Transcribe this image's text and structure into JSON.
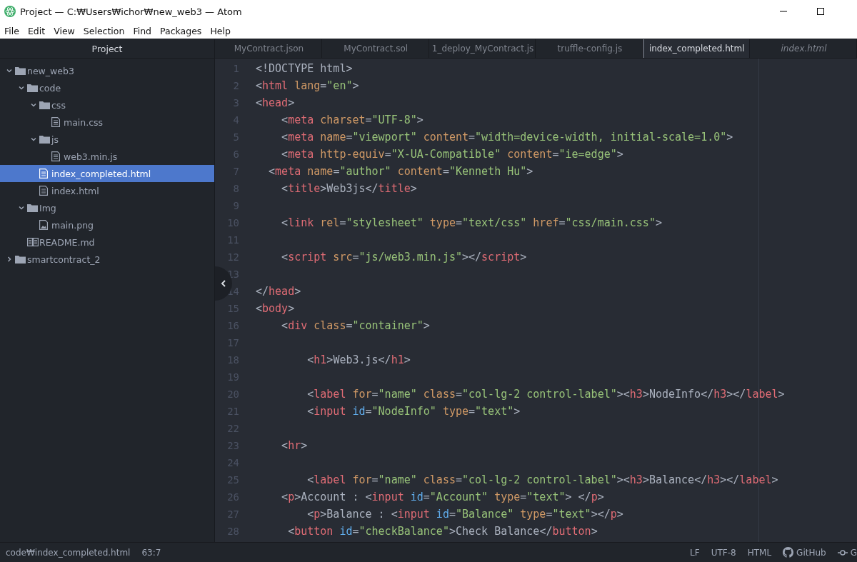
{
  "window": {
    "title": "Project — C:₩Users₩ichor₩new_web3 — Atom"
  },
  "menu": [
    "File",
    "Edit",
    "View",
    "Selection",
    "Find",
    "Packages",
    "Help"
  ],
  "sidebar": {
    "title": "Project",
    "tree": [
      {
        "name": "new_web3",
        "kind": "folder",
        "expanded": true,
        "selected": false,
        "children": [
          {
            "name": "code",
            "kind": "folder",
            "expanded": true,
            "selected": false,
            "children": [
              {
                "name": "css",
                "kind": "folder",
                "expanded": true,
                "selected": false,
                "children": [
                  {
                    "name": "main.css",
                    "kind": "file",
                    "selected": false
                  }
                ]
              },
              {
                "name": "js",
                "kind": "folder",
                "expanded": true,
                "selected": false,
                "children": [
                  {
                    "name": "web3.min.js",
                    "kind": "file",
                    "selected": false
                  }
                ]
              },
              {
                "name": "index_completed.html",
                "kind": "file",
                "selected": true
              },
              {
                "name": "index.html",
                "kind": "file",
                "selected": false
              }
            ]
          },
          {
            "name": "Img",
            "kind": "folder",
            "expanded": true,
            "selected": false,
            "children": [
              {
                "name": "main.png",
                "kind": "image",
                "selected": false
              }
            ]
          },
          {
            "name": "README.md",
            "kind": "readme",
            "selected": false
          }
        ]
      },
      {
        "name": "smartcontract_2",
        "kind": "folder",
        "expanded": false,
        "selected": false
      }
    ]
  },
  "tabs": [
    {
      "label": "MyContract.json",
      "selected": false,
      "pending": false
    },
    {
      "label": "MyContract.sol",
      "selected": false,
      "pending": false
    },
    {
      "label": "1_deploy_MyContract.js",
      "selected": false,
      "pending": false
    },
    {
      "label": "truffle-config.js",
      "selected": false,
      "pending": false
    },
    {
      "label": "index_completed.html",
      "selected": true,
      "pending": false
    },
    {
      "label": "index.html",
      "selected": false,
      "pending": true
    }
  ],
  "editor": {
    "lines": [
      {
        "number": "1",
        "tokens": [
          {
            "kind": "text",
            "text": "<!DOCTYPE html>"
          }
        ]
      },
      {
        "number": "2",
        "tokens": [
          {
            "kind": "punct",
            "text": "<"
          },
          {
            "kind": "tag",
            "text": "html"
          },
          {
            "kind": "attr",
            "text": " lang"
          },
          {
            "kind": "punct",
            "text": "="
          },
          {
            "kind": "string",
            "text": "\"en\""
          },
          {
            "kind": "punct",
            "text": ">"
          }
        ]
      },
      {
        "number": "3",
        "tokens": [
          {
            "kind": "punct",
            "text": "<"
          },
          {
            "kind": "tag",
            "text": "head"
          },
          {
            "kind": "punct",
            "text": ">"
          }
        ]
      },
      {
        "number": "4",
        "tokens": [
          {
            "kind": "punct",
            "text": "    <"
          },
          {
            "kind": "tag",
            "text": "meta"
          },
          {
            "kind": "attr",
            "text": " charset"
          },
          {
            "kind": "punct",
            "text": "="
          },
          {
            "kind": "string",
            "text": "\"UTF-8\""
          },
          {
            "kind": "punct",
            "text": ">"
          }
        ]
      },
      {
        "number": "5",
        "tokens": [
          {
            "kind": "punct",
            "text": "    <"
          },
          {
            "kind": "tag",
            "text": "meta"
          },
          {
            "kind": "attr",
            "text": " name"
          },
          {
            "kind": "punct",
            "text": "="
          },
          {
            "kind": "string",
            "text": "\"viewport\""
          },
          {
            "kind": "attr",
            "text": " content"
          },
          {
            "kind": "punct",
            "text": "="
          },
          {
            "kind": "string",
            "text": "\"width=device-width, initial-scale=1.0\""
          },
          {
            "kind": "punct",
            "text": ">"
          }
        ]
      },
      {
        "number": "6",
        "tokens": [
          {
            "kind": "punct",
            "text": "    <"
          },
          {
            "kind": "tag",
            "text": "meta"
          },
          {
            "kind": "attr",
            "text": " http-equiv"
          },
          {
            "kind": "punct",
            "text": "="
          },
          {
            "kind": "string",
            "text": "\"X-UA-Compatible\""
          },
          {
            "kind": "attr",
            "text": " content"
          },
          {
            "kind": "punct",
            "text": "="
          },
          {
            "kind": "string",
            "text": "\"ie=edge\""
          },
          {
            "kind": "punct",
            "text": ">"
          }
        ]
      },
      {
        "number": "7",
        "tokens": [
          {
            "kind": "punct",
            "text": "  <"
          },
          {
            "kind": "tag",
            "text": "meta"
          },
          {
            "kind": "attr",
            "text": " name"
          },
          {
            "kind": "punct",
            "text": "="
          },
          {
            "kind": "string",
            "text": "\"author\""
          },
          {
            "kind": "attr",
            "text": " content"
          },
          {
            "kind": "punct",
            "text": "="
          },
          {
            "kind": "string",
            "text": "\"Kenneth Hu\""
          },
          {
            "kind": "punct",
            "text": ">"
          }
        ]
      },
      {
        "number": "8",
        "tokens": [
          {
            "kind": "punct",
            "text": "    <"
          },
          {
            "kind": "tag",
            "text": "title"
          },
          {
            "kind": "punct",
            "text": ">"
          },
          {
            "kind": "text",
            "text": "Web3js"
          },
          {
            "kind": "punct",
            "text": "</"
          },
          {
            "kind": "tag",
            "text": "title"
          },
          {
            "kind": "punct",
            "text": ">"
          }
        ]
      },
      {
        "number": "9"
      },
      {
        "number": "10",
        "tokens": [
          {
            "kind": "punct",
            "text": "    <"
          },
          {
            "kind": "tag",
            "text": "link"
          },
          {
            "kind": "attr",
            "text": " rel"
          },
          {
            "kind": "punct",
            "text": "="
          },
          {
            "kind": "string",
            "text": "\"stylesheet\""
          },
          {
            "kind": "attr",
            "text": " type"
          },
          {
            "kind": "punct",
            "text": "="
          },
          {
            "kind": "string",
            "text": "\"text/css\""
          },
          {
            "kind": "attr",
            "text": " href"
          },
          {
            "kind": "punct",
            "text": "="
          },
          {
            "kind": "string",
            "text": "\"css/main.css\""
          },
          {
            "kind": "punct",
            "text": ">"
          }
        ]
      },
      {
        "number": "11"
      },
      {
        "number": "12",
        "tokens": [
          {
            "kind": "punct",
            "text": "    <"
          },
          {
            "kind": "tag",
            "text": "script"
          },
          {
            "kind": "attr",
            "text": " src"
          },
          {
            "kind": "punct",
            "text": "="
          },
          {
            "kind": "string",
            "text": "\"js/web3.min.js\""
          },
          {
            "kind": "punct",
            "text": "></"
          },
          {
            "kind": "tag",
            "text": "script"
          },
          {
            "kind": "punct",
            "text": ">"
          }
        ]
      },
      {
        "number": "13"
      },
      {
        "number": "14",
        "tokens": [
          {
            "kind": "punct",
            "text": "</"
          },
          {
            "kind": "tag",
            "text": "head"
          },
          {
            "kind": "punct",
            "text": ">"
          }
        ]
      },
      {
        "number": "15",
        "tokens": [
          {
            "kind": "punct",
            "text": "<"
          },
          {
            "kind": "tag",
            "text": "body"
          },
          {
            "kind": "punct",
            "text": ">"
          }
        ]
      },
      {
        "number": "16",
        "tokens": [
          {
            "kind": "punct",
            "text": "    <"
          },
          {
            "kind": "tag",
            "text": "div"
          },
          {
            "kind": "attr",
            "text": " class"
          },
          {
            "kind": "punct",
            "text": "="
          },
          {
            "kind": "string",
            "text": "\"container\""
          },
          {
            "kind": "punct",
            "text": ">"
          }
        ]
      },
      {
        "number": "17"
      },
      {
        "number": "18",
        "tokens": [
          {
            "kind": "punct",
            "text": "        <"
          },
          {
            "kind": "tag",
            "text": "h1"
          },
          {
            "kind": "punct",
            "text": ">"
          },
          {
            "kind": "text",
            "text": "Web3.js"
          },
          {
            "kind": "punct",
            "text": "</"
          },
          {
            "kind": "tag",
            "text": "h1"
          },
          {
            "kind": "punct",
            "text": ">"
          }
        ]
      },
      {
        "number": "19"
      },
      {
        "number": "20",
        "tokens": [
          {
            "kind": "punct",
            "text": "        <"
          },
          {
            "kind": "tag",
            "text": "label"
          },
          {
            "kind": "attr",
            "text": " for"
          },
          {
            "kind": "punct",
            "text": "="
          },
          {
            "kind": "string",
            "text": "\"name\""
          },
          {
            "kind": "attr",
            "text": " class"
          },
          {
            "kind": "punct",
            "text": "="
          },
          {
            "kind": "string",
            "text": "\"col-lg-2 control-label\""
          },
          {
            "kind": "punct",
            "text": "><"
          },
          {
            "kind": "tag",
            "text": "h3"
          },
          {
            "kind": "punct",
            "text": ">"
          },
          {
            "kind": "text",
            "text": "NodeInfo"
          },
          {
            "kind": "punct",
            "text": "</"
          },
          {
            "kind": "tag",
            "text": "h3"
          },
          {
            "kind": "punct",
            "text": "></"
          },
          {
            "kind": "tag",
            "text": "label"
          },
          {
            "kind": "punct",
            "text": ">"
          }
        ]
      },
      {
        "number": "21",
        "tokens": [
          {
            "kind": "punct",
            "text": "        <"
          },
          {
            "kind": "tag",
            "text": "input"
          },
          {
            "kind": "id",
            "text": " id"
          },
          {
            "kind": "punct",
            "text": "="
          },
          {
            "kind": "string",
            "text": "\"NodeInfo\""
          },
          {
            "kind": "attr",
            "text": " type"
          },
          {
            "kind": "punct",
            "text": "="
          },
          {
            "kind": "string",
            "text": "\"text\""
          },
          {
            "kind": "punct",
            "text": ">"
          }
        ]
      },
      {
        "number": "22"
      },
      {
        "number": "23",
        "tokens": [
          {
            "kind": "punct",
            "text": "    <"
          },
          {
            "kind": "tag",
            "text": "hr"
          },
          {
            "kind": "punct",
            "text": ">"
          }
        ]
      },
      {
        "number": "24"
      },
      {
        "number": "25",
        "tokens": [
          {
            "kind": "punct",
            "text": "        <"
          },
          {
            "kind": "tag",
            "text": "label"
          },
          {
            "kind": "attr",
            "text": " for"
          },
          {
            "kind": "punct",
            "text": "="
          },
          {
            "kind": "string",
            "text": "\"name\""
          },
          {
            "kind": "attr",
            "text": " class"
          },
          {
            "kind": "punct",
            "text": "="
          },
          {
            "kind": "string",
            "text": "\"col-lg-2 control-label\""
          },
          {
            "kind": "punct",
            "text": "><"
          },
          {
            "kind": "tag",
            "text": "h3"
          },
          {
            "kind": "punct",
            "text": ">"
          },
          {
            "kind": "text",
            "text": "Balance"
          },
          {
            "kind": "punct",
            "text": "</"
          },
          {
            "kind": "tag",
            "text": "h3"
          },
          {
            "kind": "punct",
            "text": "></"
          },
          {
            "kind": "tag",
            "text": "label"
          },
          {
            "kind": "punct",
            "text": ">"
          }
        ]
      },
      {
        "number": "26",
        "tokens": [
          {
            "kind": "punct",
            "text": "    <"
          },
          {
            "kind": "tag",
            "text": "p"
          },
          {
            "kind": "punct",
            "text": ">"
          },
          {
            "kind": "text",
            "text": "Account : "
          },
          {
            "kind": "punct",
            "text": "<"
          },
          {
            "kind": "tag",
            "text": "input"
          },
          {
            "kind": "id",
            "text": " id"
          },
          {
            "kind": "punct",
            "text": "="
          },
          {
            "kind": "string",
            "text": "\"Account\""
          },
          {
            "kind": "attr",
            "text": " type"
          },
          {
            "kind": "punct",
            "text": "="
          },
          {
            "kind": "string",
            "text": "\"text\""
          },
          {
            "kind": "punct",
            "text": "> </"
          },
          {
            "kind": "tag",
            "text": "p"
          },
          {
            "kind": "punct",
            "text": ">"
          }
        ]
      },
      {
        "number": "27",
        "tokens": [
          {
            "kind": "punct",
            "text": "        <"
          },
          {
            "kind": "tag",
            "text": "p"
          },
          {
            "kind": "punct",
            "text": ">"
          },
          {
            "kind": "text",
            "text": "Balance : "
          },
          {
            "kind": "punct",
            "text": "<"
          },
          {
            "kind": "tag",
            "text": "input"
          },
          {
            "kind": "id",
            "text": " id"
          },
          {
            "kind": "punct",
            "text": "="
          },
          {
            "kind": "string",
            "text": "\"Balance\""
          },
          {
            "kind": "attr",
            "text": " type"
          },
          {
            "kind": "punct",
            "text": "="
          },
          {
            "kind": "string",
            "text": "\"text\""
          },
          {
            "kind": "punct",
            "text": "></"
          },
          {
            "kind": "tag",
            "text": "p"
          },
          {
            "kind": "punct",
            "text": ">"
          }
        ]
      },
      {
        "number": "28",
        "tokens": [
          {
            "kind": "punct",
            "text": "     <"
          },
          {
            "kind": "tag",
            "text": "button"
          },
          {
            "kind": "id",
            "text": " id"
          },
          {
            "kind": "punct",
            "text": "="
          },
          {
            "kind": "string",
            "text": "\"checkBalance\""
          },
          {
            "kind": "punct",
            "text": ">"
          },
          {
            "kind": "text",
            "text": "Check Balance"
          },
          {
            "kind": "punct",
            "text": "</"
          },
          {
            "kind": "tag",
            "text": "button"
          },
          {
            "kind": "punct",
            "text": ">"
          }
        ]
      }
    ]
  },
  "status_bar": {
    "path": "code₩index_completed.html",
    "cursor": "63:7",
    "line_ending": "LF",
    "encoding": "UTF-8",
    "grammar": "HTML",
    "github": "GitHub",
    "git": "G"
  }
}
